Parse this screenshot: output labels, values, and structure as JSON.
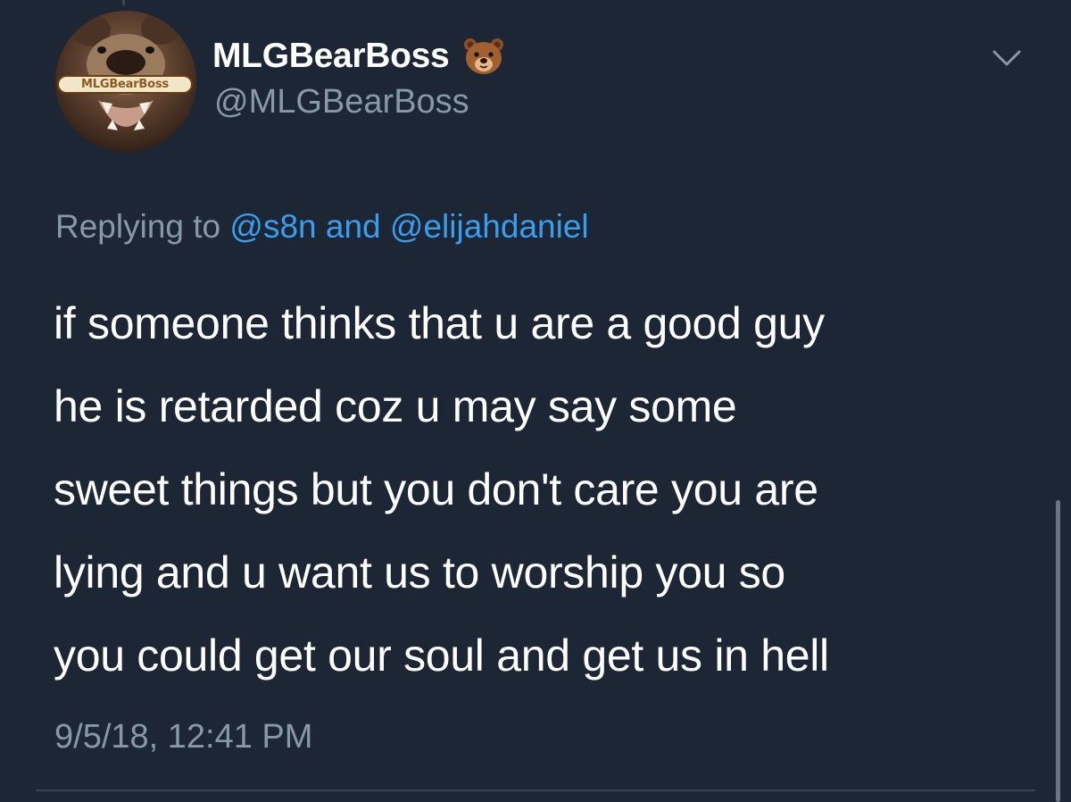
{
  "tweet": {
    "display_name": "MLGBearBoss",
    "handle": "@MLGBearBoss",
    "avatar_label": "MLGBearBoss",
    "name_emoji_icon": "bear-face-icon",
    "menu_icon": "chevron-down-icon",
    "reply": {
      "prefix": "Replying to",
      "mention_1": "@s8n",
      "conjunction": "and",
      "mention_2": "@elijahdaniel"
    },
    "text_lines": [
      "if someone thinks that u are a good guy",
      "he is retarded coz u may say some",
      "sweet things but you don't care you are",
      "lying and u want us to worship you so",
      "you could get our soul and get us in hell"
    ],
    "timestamp": "9/5/18, 12:41 PM"
  },
  "colors": {
    "background": "#1c2634",
    "primary_text": "#ffffff",
    "secondary_text": "#8899a6",
    "link": "#3b9dee",
    "divider": "#38444d"
  }
}
